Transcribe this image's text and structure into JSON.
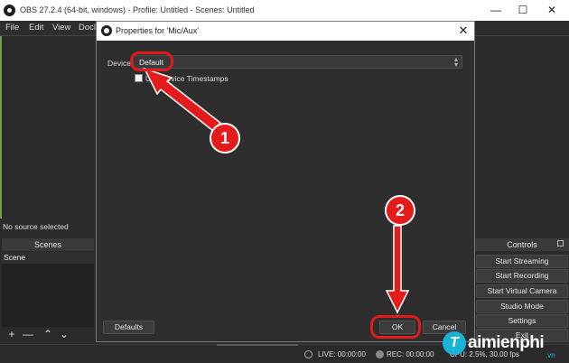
{
  "window": {
    "title": "OBS 27.2.4 (64-bit, windows) - Profile: Untitled - Scenes: Untitled",
    "minimize": "—",
    "maximize": "☐",
    "close": "✕"
  },
  "menu": {
    "items": [
      "File",
      "Edit",
      "View",
      "Docl"
    ]
  },
  "preview": {
    "no_source": "No source selected"
  },
  "scenes": {
    "header": "Scenes",
    "items": [
      "Scene"
    ],
    "tools": [
      "+",
      "—",
      "⌃",
      "⌄"
    ]
  },
  "controls": {
    "header": "Controls",
    "buttons": [
      "Start Streaming",
      "Start Recording",
      "Start Virtual Camera",
      "Studio Mode",
      "Settings",
      "Exit"
    ]
  },
  "status": {
    "live": "LIVE: 00:00:00",
    "rec": "REC: 00:00:00",
    "cpu": "CPU: 2.5%, 30.00 fps"
  },
  "dialog": {
    "title": "Properties for 'Mic/Aux'",
    "close": "✕",
    "device_label": "Device",
    "device_value": "Default",
    "checkbox_label": "Use Device Timestamps",
    "defaults_button": "Defaults",
    "ok_button": "OK",
    "cancel_button": "Cancel"
  },
  "annotations": {
    "step1": "1",
    "step2": "2",
    "color": "#e41b1b"
  },
  "watermark": {
    "logo": "T",
    "text": "aimienphi",
    "tld": ".vn"
  }
}
